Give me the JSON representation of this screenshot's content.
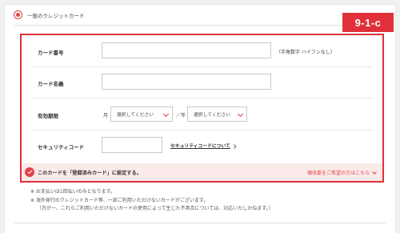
{
  "payment_option": {
    "label": "一般のクレジットカード"
  },
  "badge": "9-1-c",
  "form": {
    "card_number": {
      "label": "カード番号",
      "value": "",
      "hint": "（半角数字 ハイフンなし）"
    },
    "card_name": {
      "label": "カード名義",
      "value": ""
    },
    "expiry": {
      "label": "有効期限",
      "month_label": "月",
      "month_select": "選択してください",
      "separator": "／",
      "year_label": "年",
      "year_select": "選択してください"
    },
    "security_code": {
      "label": "セキュリティコード",
      "value": "",
      "link": "セキュリティコードについて"
    }
  },
  "register": {
    "text": "このカードを「登録済みカード」に設定する。",
    "checked": true,
    "notice_link": "個収委をご希望の方はこちら"
  },
  "notes": [
    "※ お支払いは1回払いのみとなります。",
    "※ 海外発行のクレジットカード等、一部ご利用いただけないカードがございます。",
    "（万が一、これらご利用いただけないカードの使用によって生じた不具合については、対応いたしかねます。）"
  ],
  "colors": {
    "accent": "#e0313a",
    "pink_bar": "#fbeaea"
  }
}
